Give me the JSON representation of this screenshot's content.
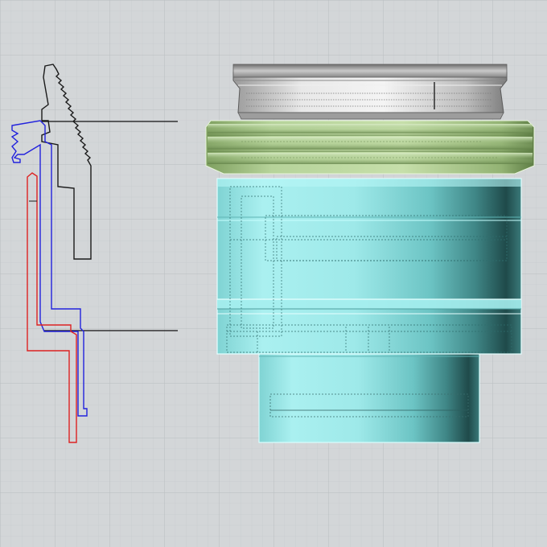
{
  "viewport": {
    "background_color": "#d3d6d8",
    "grid_minor_color": "#c6cacd",
    "grid_major_color": "#b8bdc1"
  },
  "profiles": {
    "nut_outline_color": "#1a1a1a",
    "sleeve_outline_color": "#2222dd",
    "tube_outline_color": "#dd2222",
    "section_line_color": "#111111"
  },
  "model": {
    "ring_color": "#d8d8d8",
    "thread_band_color": "#a9c98a",
    "barrel_color": "#8fe3e3",
    "barrel_dark_color": "#1f4a4a",
    "edge_highlight_color": "#e6ffff"
  }
}
